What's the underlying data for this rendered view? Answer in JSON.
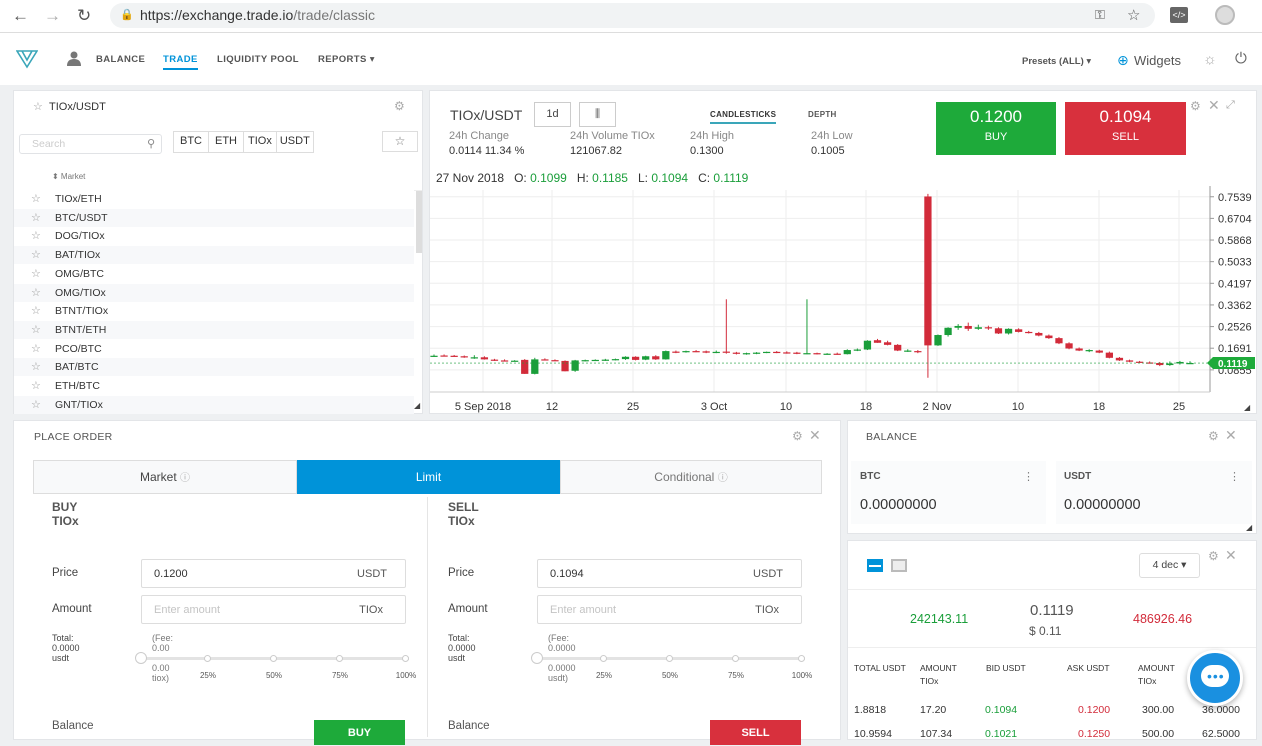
{
  "browser": {
    "url_host": "https://exchange.trade.io",
    "url_path": "/trade/classic"
  },
  "nav": {
    "balance": "BALANCE",
    "trade": "TRADE",
    "liquidity": "LIQUIDITY POOL",
    "reports": "REPORTS ▾",
    "presets": "Presets (ALL) ▾",
    "widgets": "Widgets"
  },
  "market_panel": {
    "title": "TIOx/USDT",
    "search_placeholder": "Search",
    "filters": [
      "BTC",
      "ETH",
      "TIOx",
      "USDT"
    ],
    "column": "⬍ Market",
    "markets": [
      "TIOx/ETH",
      "BTC/USDT",
      "DOG/TIOx",
      "BAT/TIOx",
      "OMG/BTC",
      "OMG/TIOx",
      "BTNT/TIOx",
      "BTNT/ETH",
      "PCO/BTC",
      "BAT/BTC",
      "ETH/BTC",
      "GNT/TIOx"
    ]
  },
  "chart_panel": {
    "pair": "TIOx/USDT",
    "interval": "1d",
    "tab_candles": "CANDLESTICKS",
    "tab_depth": "DEPTH",
    "stats": [
      {
        "label": "24h Change",
        "value": "0.0114 11.34 %"
      },
      {
        "label": "24h Volume TIOx",
        "value": "121067.82"
      },
      {
        "label": "24h High",
        "value": "0.1300"
      },
      {
        "label": "24h Low",
        "value": "0.1005"
      }
    ],
    "buy_price": "0.1200",
    "buy_label": "BUY",
    "sell_price": "0.1094",
    "sell_label": "SELL",
    "ohlc": {
      "date": "27 Nov 2018",
      "o_label": "O:",
      "o": "0.1099",
      "h_label": "H:",
      "h": "0.1185",
      "l_label": "L:",
      "l": "0.1094",
      "c_label": "C:",
      "c": "0.1119"
    },
    "last_price": "0.1119"
  },
  "chart_data": {
    "type": "candlestick",
    "title": "TIOx/USDT",
    "y_ticks": [
      0.7539,
      0.6704,
      0.5868,
      0.5033,
      0.4197,
      0.3362,
      0.2526,
      0.1691,
      0.0855
    ],
    "ylim": [
      0.0,
      0.78
    ],
    "x_ticks": [
      "5 Sep 2018",
      "12",
      "25",
      "3 Oct",
      "10",
      "18",
      "2 Nov",
      "10",
      "18",
      "25"
    ],
    "grid": true,
    "candles": [
      {
        "o": 0.14,
        "h": 0.145,
        "l": 0.135,
        "c": 0.14
      },
      {
        "o": 0.141,
        "h": 0.145,
        "l": 0.137,
        "c": 0.14
      },
      {
        "o": 0.14,
        "h": 0.143,
        "l": 0.136,
        "c": 0.138
      },
      {
        "o": 0.138,
        "h": 0.141,
        "l": 0.132,
        "c": 0.135
      },
      {
        "o": 0.133,
        "h": 0.142,
        "l": 0.128,
        "c": 0.134
      },
      {
        "o": 0.134,
        "h": 0.138,
        "l": 0.125,
        "c": 0.126
      },
      {
        "o": 0.125,
        "h": 0.128,
        "l": 0.12,
        "c": 0.122
      },
      {
        "o": 0.122,
        "h": 0.126,
        "l": 0.12,
        "c": 0.121
      },
      {
        "o": 0.12,
        "h": 0.123,
        "l": 0.118,
        "c": 0.121
      },
      {
        "o": 0.124,
        "h": 0.127,
        "l": 0.07,
        "c": 0.07
      },
      {
        "o": 0.07,
        "h": 0.132,
        "l": 0.068,
        "c": 0.126
      },
      {
        "o": 0.126,
        "h": 0.13,
        "l": 0.122,
        "c": 0.124
      },
      {
        "o": 0.123,
        "h": 0.126,
        "l": 0.12,
        "c": 0.121
      },
      {
        "o": 0.12,
        "h": 0.122,
        "l": 0.08,
        "c": 0.08
      },
      {
        "o": 0.082,
        "h": 0.124,
        "l": 0.078,
        "c": 0.122
      },
      {
        "o": 0.121,
        "h": 0.125,
        "l": 0.118,
        "c": 0.123
      },
      {
        "o": 0.123,
        "h": 0.126,
        "l": 0.12,
        "c": 0.124
      },
      {
        "o": 0.124,
        "h": 0.128,
        "l": 0.12,
        "c": 0.125
      },
      {
        "o": 0.125,
        "h": 0.129,
        "l": 0.122,
        "c": 0.127
      },
      {
        "o": 0.127,
        "h": 0.138,
        "l": 0.124,
        "c": 0.136
      },
      {
        "o": 0.136,
        "h": 0.138,
        "l": 0.122,
        "c": 0.124
      },
      {
        "o": 0.125,
        "h": 0.14,
        "l": 0.123,
        "c": 0.138
      },
      {
        "o": 0.138,
        "h": 0.142,
        "l": 0.124,
        "c": 0.126
      },
      {
        "o": 0.126,
        "h": 0.16,
        "l": 0.125,
        "c": 0.158
      },
      {
        "o": 0.156,
        "h": 0.16,
        "l": 0.15,
        "c": 0.154
      },
      {
        "o": 0.155,
        "h": 0.16,
        "l": 0.152,
        "c": 0.158
      },
      {
        "o": 0.158,
        "h": 0.162,
        "l": 0.154,
        "c": 0.156
      },
      {
        "o": 0.157,
        "h": 0.16,
        "l": 0.15,
        "c": 0.152
      },
      {
        "o": 0.153,
        "h": 0.16,
        "l": 0.15,
        "c": 0.155
      },
      {
        "o": 0.156,
        "h": 0.358,
        "l": 0.148,
        "c": 0.152
      },
      {
        "o": 0.152,
        "h": 0.155,
        "l": 0.145,
        "c": 0.148
      },
      {
        "o": 0.148,
        "h": 0.152,
        "l": 0.144,
        "c": 0.15
      },
      {
        "o": 0.15,
        "h": 0.154,
        "l": 0.146,
        "c": 0.152
      },
      {
        "o": 0.152,
        "h": 0.156,
        "l": 0.15,
        "c": 0.155
      },
      {
        "o": 0.155,
        "h": 0.158,
        "l": 0.15,
        "c": 0.152
      },
      {
        "o": 0.153,
        "h": 0.157,
        "l": 0.148,
        "c": 0.15
      },
      {
        "o": 0.152,
        "h": 0.155,
        "l": 0.146,
        "c": 0.148
      },
      {
        "o": 0.148,
        "h": 0.358,
        "l": 0.146,
        "c": 0.15
      },
      {
        "o": 0.15,
        "h": 0.152,
        "l": 0.145,
        "c": 0.146
      },
      {
        "o": 0.147,
        "h": 0.15,
        "l": 0.144,
        "c": 0.148
      },
      {
        "o": 0.148,
        "h": 0.152,
        "l": 0.144,
        "c": 0.146
      },
      {
        "o": 0.146,
        "h": 0.165,
        "l": 0.145,
        "c": 0.162
      },
      {
        "o": 0.162,
        "h": 0.168,
        "l": 0.158,
        "c": 0.164
      },
      {
        "o": 0.164,
        "h": 0.2,
        "l": 0.162,
        "c": 0.198
      },
      {
        "o": 0.2,
        "h": 0.205,
        "l": 0.19,
        "c": 0.19
      },
      {
        "o": 0.192,
        "h": 0.198,
        "l": 0.18,
        "c": 0.182
      },
      {
        "o": 0.182,
        "h": 0.185,
        "l": 0.158,
        "c": 0.16
      },
      {
        "o": 0.16,
        "h": 0.165,
        "l": 0.155,
        "c": 0.16
      },
      {
        "o": 0.158,
        "h": 0.162,
        "l": 0.15,
        "c": 0.155
      },
      {
        "o": 0.755,
        "h": 0.765,
        "l": 0.055,
        "c": 0.18
      },
      {
        "o": 0.18,
        "h": 0.222,
        "l": 0.178,
        "c": 0.22
      },
      {
        "o": 0.22,
        "h": 0.25,
        "l": 0.214,
        "c": 0.248
      },
      {
        "o": 0.248,
        "h": 0.262,
        "l": 0.24,
        "c": 0.255
      },
      {
        "o": 0.255,
        "h": 0.268,
        "l": 0.236,
        "c": 0.244
      },
      {
        "o": 0.244,
        "h": 0.26,
        "l": 0.24,
        "c": 0.25
      },
      {
        "o": 0.25,
        "h": 0.256,
        "l": 0.24,
        "c": 0.246
      },
      {
        "o": 0.246,
        "h": 0.25,
        "l": 0.224,
        "c": 0.226
      },
      {
        "o": 0.226,
        "h": 0.246,
        "l": 0.222,
        "c": 0.244
      },
      {
        "o": 0.242,
        "h": 0.246,
        "l": 0.23,
        "c": 0.232
      },
      {
        "o": 0.232,
        "h": 0.236,
        "l": 0.226,
        "c": 0.228
      },
      {
        "o": 0.228,
        "h": 0.232,
        "l": 0.215,
        "c": 0.218
      },
      {
        "o": 0.218,
        "h": 0.222,
        "l": 0.205,
        "c": 0.208
      },
      {
        "o": 0.208,
        "h": 0.212,
        "l": 0.185,
        "c": 0.188
      },
      {
        "o": 0.188,
        "h": 0.192,
        "l": 0.165,
        "c": 0.168
      },
      {
        "o": 0.168,
        "h": 0.172,
        "l": 0.158,
        "c": 0.16
      },
      {
        "o": 0.16,
        "h": 0.165,
        "l": 0.154,
        "c": 0.162
      },
      {
        "o": 0.16,
        "h": 0.163,
        "l": 0.15,
        "c": 0.152
      },
      {
        "o": 0.152,
        "h": 0.156,
        "l": 0.13,
        "c": 0.132
      },
      {
        "o": 0.132,
        "h": 0.135,
        "l": 0.12,
        "c": 0.122
      },
      {
        "o": 0.122,
        "h": 0.125,
        "l": 0.115,
        "c": 0.117
      },
      {
        "o": 0.117,
        "h": 0.12,
        "l": 0.112,
        "c": 0.114
      },
      {
        "o": 0.114,
        "h": 0.118,
        "l": 0.11,
        "c": 0.112
      },
      {
        "o": 0.112,
        "h": 0.116,
        "l": 0.1,
        "c": 0.104
      },
      {
        "o": 0.104,
        "h": 0.118,
        "l": 0.101,
        "c": 0.11
      },
      {
        "o": 0.11,
        "h": 0.12,
        "l": 0.106,
        "c": 0.116
      },
      {
        "o": 0.1099,
        "h": 0.1185,
        "l": 0.1094,
        "c": 0.1119
      }
    ]
  },
  "order": {
    "title": "PLACE ORDER",
    "tabs": [
      "Market",
      "Limit",
      "Conditional"
    ],
    "buy": {
      "title": "BUY TIOx",
      "price_label": "Price",
      "price": "0.1200",
      "price_unit": "USDT",
      "amount_label": "Amount",
      "amount_placeholder": "Enter amount",
      "amount_unit": "TIOx",
      "total": "Total: 0.0000 usdt",
      "fee": "(Fee: 0.00 - 0.00 tiox)",
      "balance_label": "Balance",
      "button": "BUY"
    },
    "sell": {
      "title": "SELL TIOx",
      "price_label": "Price",
      "price": "0.1094",
      "price_unit": "USDT",
      "amount_label": "Amount",
      "amount_placeholder": "Enter amount",
      "amount_unit": "TIOx",
      "total": "Total: 0.0000 usdt",
      "fee": "(Fee: 0.0000 - 0.0000 usdt)",
      "balance_label": "Balance",
      "button": "SELL"
    },
    "slider_ticks": [
      "25%",
      "50%",
      "75%",
      "100%"
    ]
  },
  "balance": {
    "title": "BALANCE",
    "items": [
      {
        "currency": "BTC",
        "amount": "0.00000000"
      },
      {
        "currency": "USDT",
        "amount": "0.00000000"
      }
    ]
  },
  "orderbook": {
    "decimals": "4 dec ▾",
    "bid_total": "242143.11",
    "last": "0.1119",
    "last_usd": "$ 0.11",
    "ask_total": "486926.46",
    "headers": [
      "TOTAL USDT",
      "AMOUNT TIOx",
      "BID USDT",
      "ASK USDT",
      "AMOUNT TIOx",
      "TOTAL"
    ],
    "rows": [
      {
        "total_bid": "1.8818",
        "amount_bid": "17.20",
        "bid": "0.1094",
        "ask": "0.1200",
        "amount_ask": "300.00",
        "total_ask": "36.0000"
      },
      {
        "total_bid": "10.9594",
        "amount_bid": "107.34",
        "bid": "0.1021",
        "ask": "0.1250",
        "amount_ask": "500.00",
        "total_ask": "62.5000"
      }
    ]
  },
  "colors": {
    "accent": "#0093d9",
    "buy": "#1eaa3a",
    "sell": "#d8303d",
    "up": "#1a9e3a",
    "down": "#d22b3a"
  }
}
